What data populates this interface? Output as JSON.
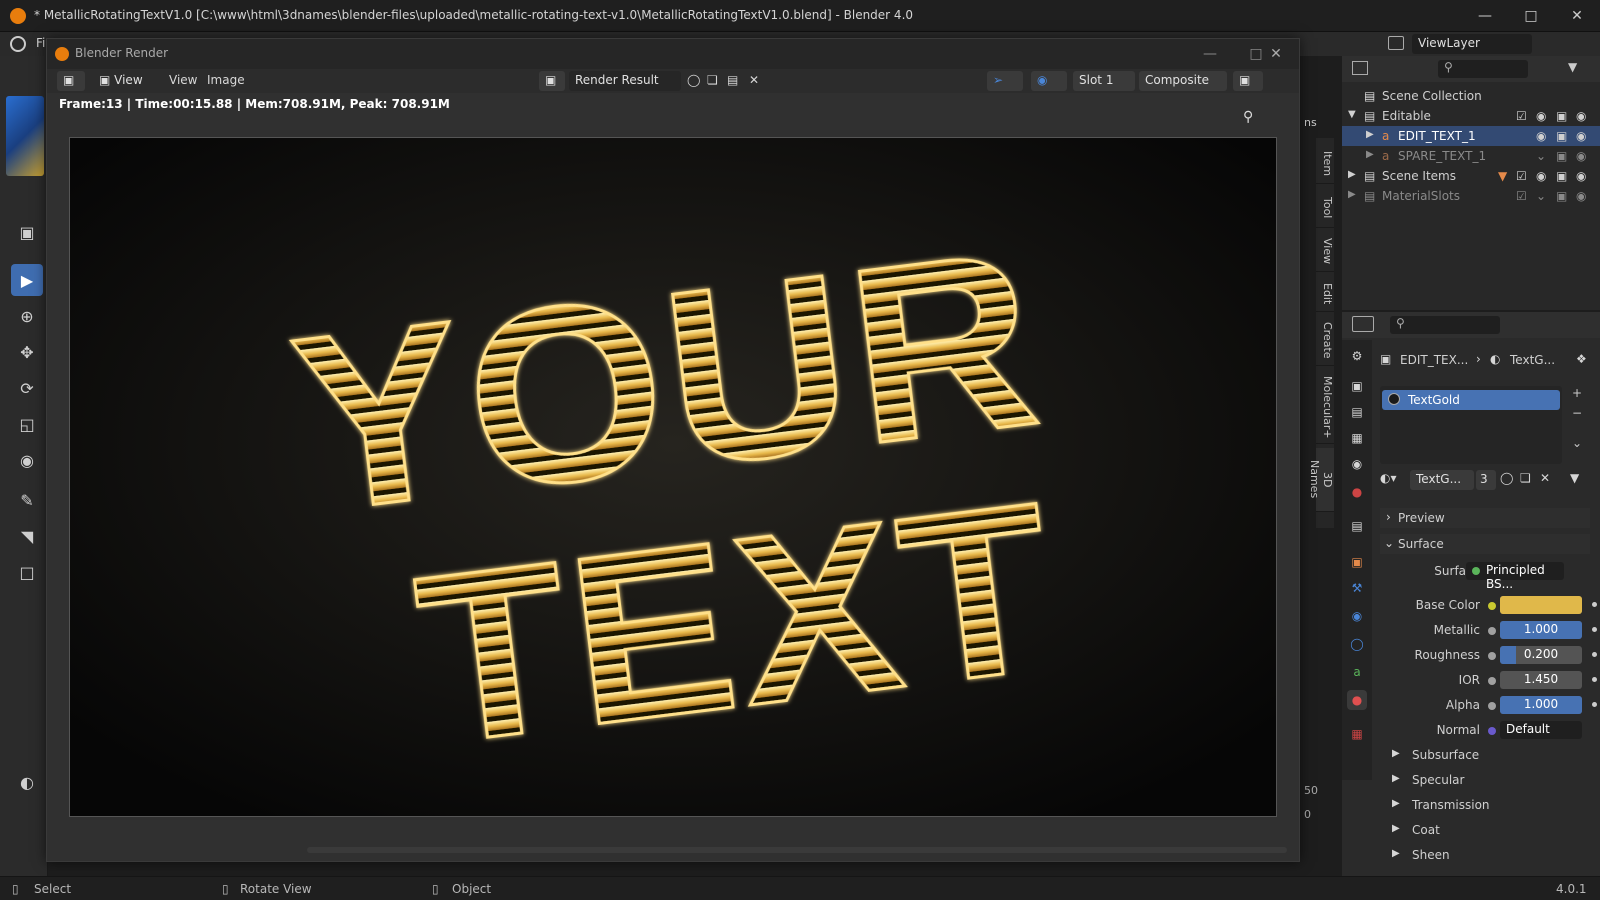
{
  "window": {
    "title": "* MetallicRotatingTextV1.0 [C:\\www\\html\\3dnames\\blender-files\\uploaded\\metallic-rotating-text-v1.0\\MetallicRotatingTextV1.0.blend] - Blender 4.0"
  },
  "topbar": {
    "menu_file": "Fi",
    "view_layer": "ViewLayer"
  },
  "render_window": {
    "title": "Blender Render",
    "menu": {
      "view": "View",
      "view2": "View",
      "image": "Image"
    },
    "image_name": "Render Result",
    "slot": "Slot 1",
    "pass": "Composite",
    "stats": "Frame:13 | Time:00:15.88 | Mem:708.91M, Peak: 708.91M",
    "render_text": {
      "line1": "YOUR",
      "line2": "TEXT"
    }
  },
  "side_tabs": [
    "Item",
    "Tool",
    "View",
    "Edit",
    "Create",
    "Molecular+",
    "3D Names"
  ],
  "side_value": "50",
  "side_value2": "0",
  "side_partial": "ns",
  "outliner": {
    "scene_collection": "Scene Collection",
    "rows": [
      {
        "label": "Editable"
      },
      {
        "label": "EDIT_TEXT_1"
      },
      {
        "label": "SPARE_TEXT_1"
      },
      {
        "label": "Scene Items"
      },
      {
        "label": "MaterialSlots"
      }
    ]
  },
  "properties": {
    "breadcrumb_object": "EDIT_TEX...",
    "breadcrumb_material": "TextG...",
    "material_slot": "TextGold",
    "material_name": "TextG...",
    "users": "3",
    "sections": {
      "preview": "Preview",
      "surface": "Surface"
    },
    "surface": {
      "label": "Surface",
      "value": "Principled BS..."
    },
    "fields": [
      {
        "label": "Base Color",
        "value": "",
        "fill": 1.0,
        "color": "#e0b84a"
      },
      {
        "label": "Metallic",
        "value": "1.000",
        "fill": 1.0,
        "color": "#4772b3"
      },
      {
        "label": "Roughness",
        "value": "0.200",
        "fill": 0.2,
        "color": "#4772b3"
      },
      {
        "label": "IOR",
        "value": "1.450",
        "fill": 0.0,
        "color": "#4772b3"
      },
      {
        "label": "Alpha",
        "value": "1.000",
        "fill": 1.0,
        "color": "#4772b3"
      },
      {
        "label": "Normal",
        "value": "Default",
        "fill": 0.0,
        "color": "#4772b3"
      }
    ],
    "subsections": [
      "Subsurface",
      "Specular",
      "Transmission",
      "Coat",
      "Sheen"
    ]
  },
  "statusbar": {
    "select": "Select",
    "rotate": "Rotate View",
    "object": "Object",
    "version": "4.0.1"
  },
  "colors": {
    "accent": "#4772b3",
    "gold": "#e0b84a",
    "selected_row": "#334a73"
  }
}
